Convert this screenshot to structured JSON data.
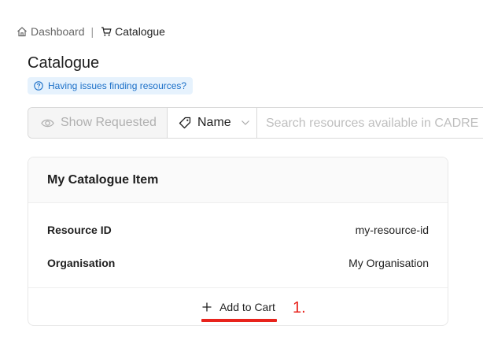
{
  "breadcrumb": {
    "dashboard": "Dashboard",
    "separator": "|",
    "current": "Catalogue"
  },
  "page": {
    "title": "Catalogue",
    "help_text": "Having issues finding resources?"
  },
  "toolbar": {
    "show_requested_label": "Show Requested",
    "field_selected": "Name",
    "search_placeholder": "Search resources available in CADRE"
  },
  "card": {
    "title": "My Catalogue Item",
    "fields": [
      {
        "label": "Resource ID",
        "value": "my-resource-id"
      },
      {
        "label": "Organisation",
        "value": "My Organisation"
      }
    ],
    "add_to_cart_label": "Add to Cart"
  },
  "annotation": {
    "step": "1."
  },
  "colors": {
    "accent_blue": "#1a6fc8",
    "help_bg": "#e6f2fd",
    "annotation_red": "#e8231c"
  },
  "icons": {
    "dashboard": "home-icon",
    "catalogue": "cart-icon",
    "help": "question-circle-icon",
    "show_requested": "eye-icon",
    "field": "tag-icon",
    "dropdown": "chevron-down-icon",
    "add": "plus-icon"
  }
}
